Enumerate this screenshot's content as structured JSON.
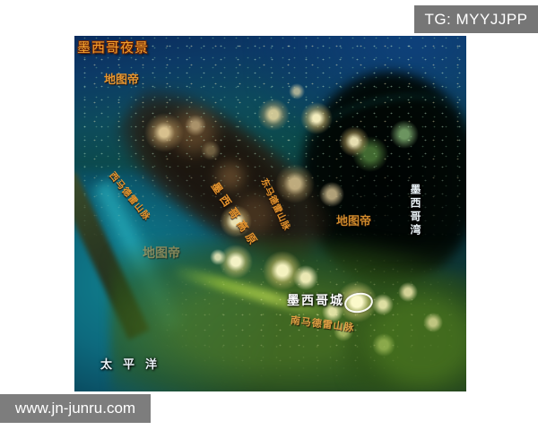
{
  "overlay": {
    "tg_badge": "TG: MYYJJPP",
    "url_badge": "www.jn-junru.com"
  },
  "map": {
    "title": "墨西哥夜景",
    "labels": {
      "watermark_north": "地图帝",
      "watermark_east": "地图帝",
      "watermark_coast": "地图帝",
      "sierra_madre_occidental": "西马德雷山脉",
      "mexican_plateau": "墨西哥高原",
      "sierra_madre_oriental": "东马德雷山脉",
      "sierra_madre_del_sur": "南马德雷山脉",
      "gulf_of_mexico": "墨西哥湾",
      "mexico_city": "墨西哥城",
      "pacific_ocean": "太平洋"
    },
    "colors": {
      "badge_bg": "#777777",
      "title_orange": "#f3a02e",
      "label_orange": "#e6952f",
      "label_white": "#eaf2f7",
      "ocean_teal": "#0d6a7e",
      "gulf_black": "#010805"
    }
  }
}
